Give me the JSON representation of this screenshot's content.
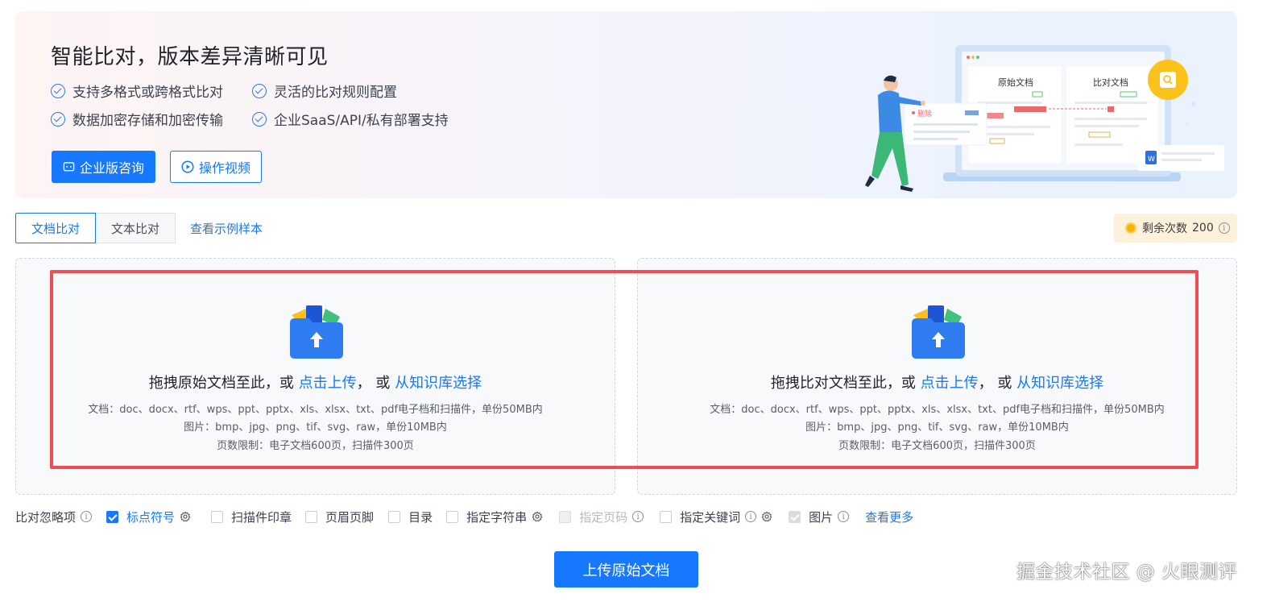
{
  "banner": {
    "title": "智能比对，版本差异清晰可见",
    "features": [
      "支持多格式或跨格式比对",
      "灵活的比对规则配置",
      "数据加密存储和加密传输",
      "企业SaaS/API/私有部署支持"
    ],
    "enterprise_button": "企业版咨询",
    "video_button": "操作视频",
    "illustration": {
      "original_label": "原始文档",
      "compare_label": "比对文档",
      "delete_tag": "删除"
    }
  },
  "tabs": [
    {
      "label": "文档比对",
      "active": true
    },
    {
      "label": "文本比对",
      "active": false
    }
  ],
  "sample_link": "查看示例样本",
  "remaining": {
    "label": "剩余次数",
    "count": "200"
  },
  "upload_left": {
    "prefix": "拖拽原始文档至此，或",
    "click_upload": "点击上传",
    "sep": "，  或",
    "kb_select": "从知识库选择",
    "spec_docs": "文档：doc、docx、rtf、wps、ppt、pptx、xls、xlsx、txt、pdf电子档和扫描件，单份50MB内",
    "spec_images": "图片：bmp、jpg、png、tif、svg、raw，单份10MB内",
    "spec_pages": "页数限制：电子文档600页，扫描件300页"
  },
  "upload_right": {
    "prefix": "拖拽比对文档至此，或",
    "click_upload": "点击上传",
    "sep": "，  或",
    "kb_select": "从知识库选择",
    "spec_docs": "文档：doc、docx、rtf、wps、ppt、pptx、xls、xlsx、txt、pdf电子档和扫描件，单份50MB内",
    "spec_images": "图片：bmp、jpg、png、tif、svg、raw，单份10MB内",
    "spec_pages": "页数限制：电子文档600页，扫描件300页"
  },
  "options": {
    "label": "比对忽略项",
    "items": {
      "punct": "标点符号",
      "stamp": "扫描件印章",
      "header_footer": "页眉页脚",
      "toc": "目录",
      "string": "指定字符串",
      "page_no": "指定页码",
      "keyword": "指定关键词",
      "image": "图片"
    },
    "more": "查看更多"
  },
  "upload_button": "上传原始文档",
  "watermark": "掘金技术社区 @ 火眼测评",
  "colors": {
    "primary": "#1677ff",
    "highlight_box": "#ef4d52"
  }
}
